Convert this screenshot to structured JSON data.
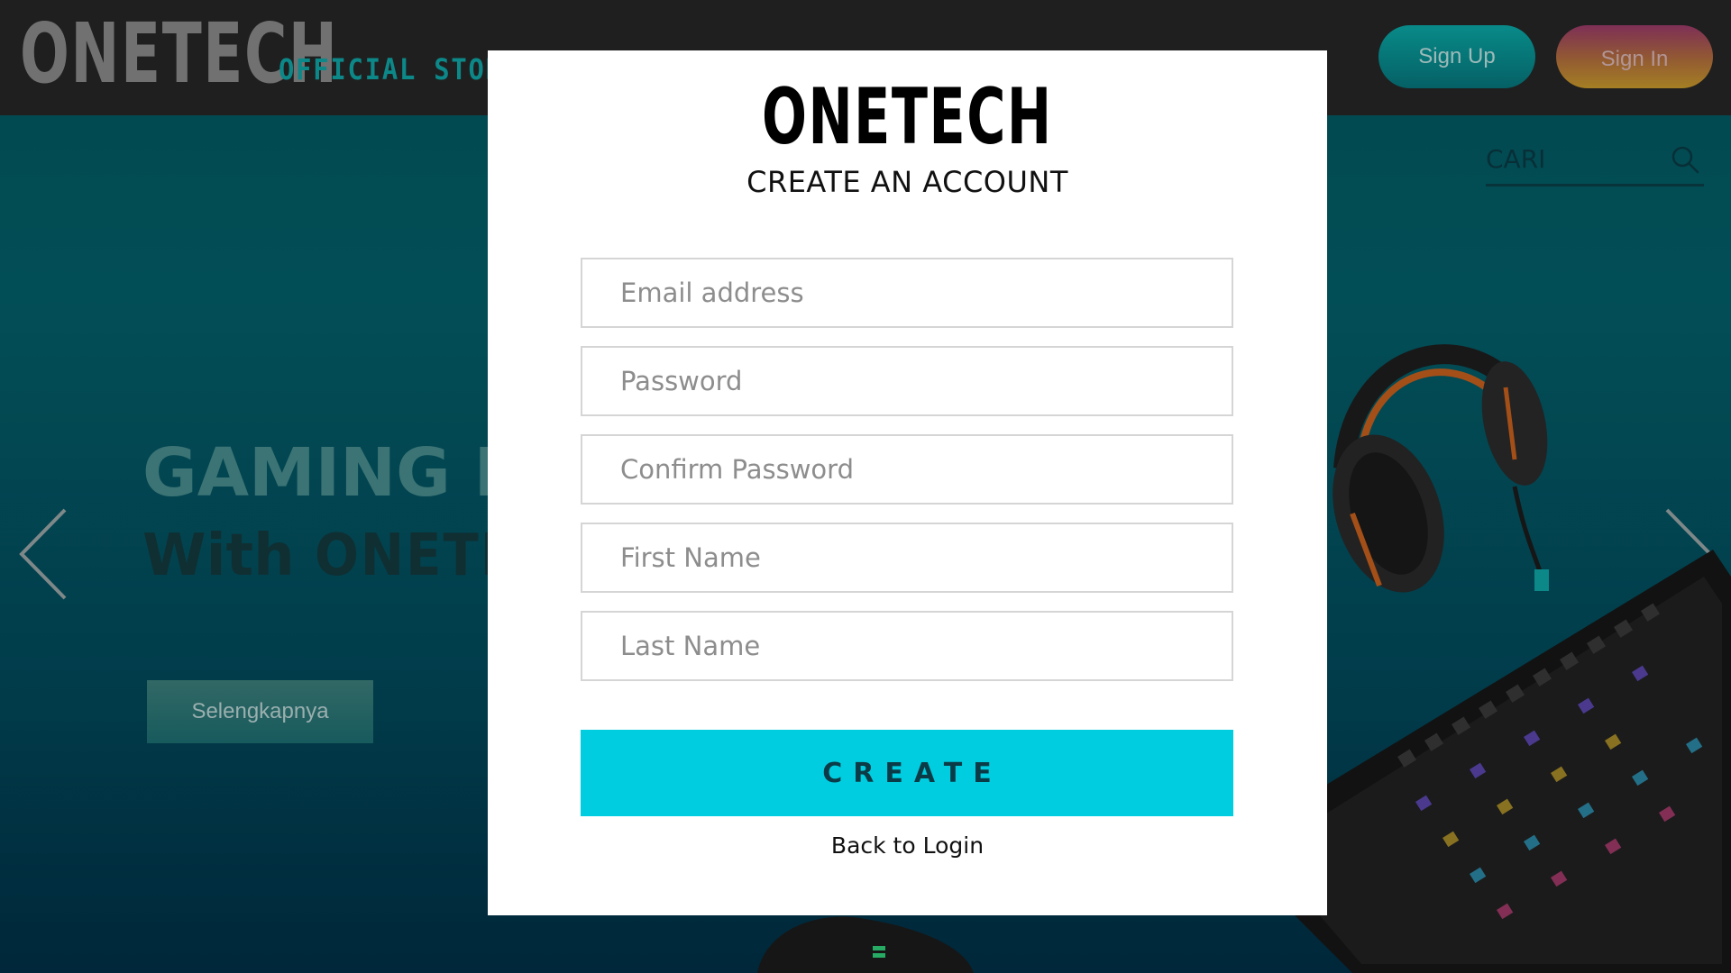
{
  "header": {
    "brand": "ONETECH",
    "brand_sub": "OFFICIAL STORE",
    "signup_label": "Sign Up",
    "signin_label": "Sign In",
    "search_placeholder": "CARI"
  },
  "hero": {
    "title": "GAMING E",
    "sub_prefix": "With ",
    "sub_brand": "ONETEC",
    "cta_label": "Selengkapnya"
  },
  "modal": {
    "logo": "ONETECH",
    "title": "CREATE AN ACCOUNT",
    "fields": {
      "email_placeholder": "Email address",
      "password_placeholder": "Password",
      "confirm_placeholder": "Confirm Password",
      "first_name_placeholder": "First Name",
      "last_name_placeholder": "Last Name"
    },
    "create_label": "CREATE",
    "back_label": "Back to Login"
  },
  "colors": {
    "accent": "#00cde0",
    "header_bg": "#262626",
    "hero_bg": "#03606a"
  },
  "icons": {
    "search": "search-icon",
    "prev": "chevron-left-icon",
    "next": "chevron-right-icon"
  }
}
